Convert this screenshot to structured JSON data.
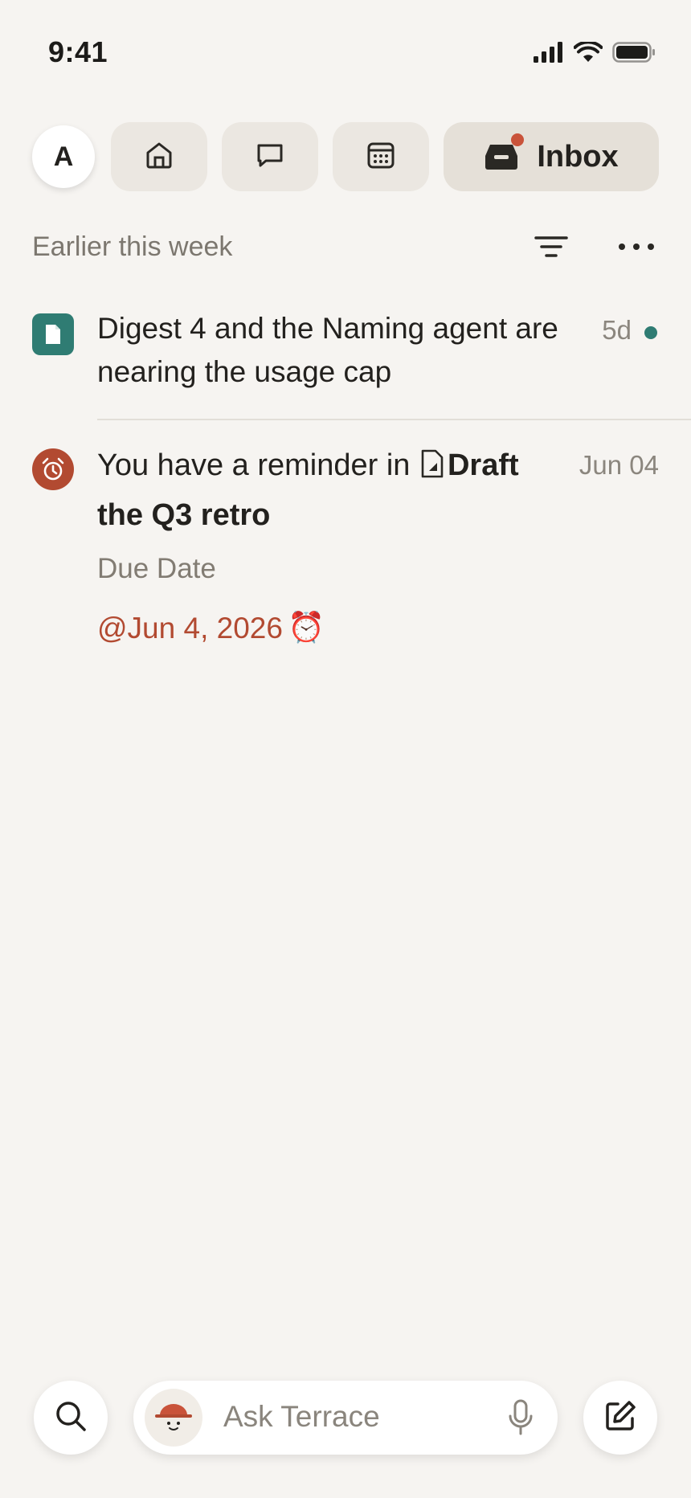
{
  "status_bar": {
    "time": "9:41",
    "icons": [
      "cellular-signal-icon",
      "wifi-icon",
      "battery-icon"
    ]
  },
  "top_nav": {
    "avatar_initial": "A",
    "tabs": [
      {
        "name": "home",
        "icon": "home-icon"
      },
      {
        "name": "chat",
        "icon": "chat-bubble-icon"
      },
      {
        "name": "calendar",
        "icon": "calendar-icon"
      }
    ],
    "inbox": {
      "label": "Inbox",
      "icon": "inbox-tray-icon",
      "has_badge": true
    }
  },
  "section": {
    "title": "Earlier this week",
    "filter_icon": "filter-icon",
    "more_icon": "more-horizontal-icon"
  },
  "notifications": [
    {
      "icon": "document-icon",
      "text": "Digest 4 and the Naming agent are nearing the usage cap",
      "time": "5d",
      "unread": true
    },
    {
      "icon": "alarm-clock-icon",
      "text_prefix": "You have a reminder in",
      "page_title": "Draft the Q3 retro",
      "time": "Jun 04",
      "property_label": "Due Date",
      "property_value": "@Jun 4, 2026",
      "property_value_emoji": "⏰"
    }
  ],
  "bottom_bar": {
    "search_icon": "search-icon",
    "ask_placeholder": "Ask Terrace",
    "assistant_icon": "assistant-face-icon",
    "mic_icon": "microphone-icon",
    "compose_icon": "compose-icon"
  },
  "colors": {
    "background": "#f6f4f1",
    "accent_teal": "#2f7c73",
    "accent_red": "#b24a31",
    "badge_red": "#c9533a",
    "muted_text": "#7c776f"
  }
}
